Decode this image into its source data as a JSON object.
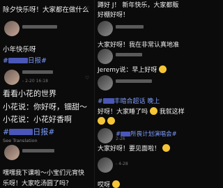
{
  "left": {
    "c1": {
      "text": "除夕快乐呀！大家都在做什么"
    },
    "c2": {
      "line1": "小年快乐呀",
      "tag_suffix": "日报#"
    },
    "c3": {
      "meta": "- 2-20 16:18",
      "line1": "看看小花的世界",
      "line2": "小花说：你好呀，钿甜～",
      "line3": "小花说：小花好香啊",
      "tag_suffix": "日报#",
      "see_translation": "See Translation"
    },
    "c4": {
      "line1": "嘿嘿我下课啦～小宝们元宵快",
      "line2": "乐呀！大家吃汤圆了吗？"
    }
  },
  "right": {
    "c1": {
      "line1": "蹲好 J！ 新年快乐，大家都贩",
      "line2": "好棚好呀！"
    },
    "c2": {
      "line1": "大家好呀！我在非常认真地准"
    },
    "c3": {
      "line1": "Jeremy说：早上好呀"
    },
    "c4": {
      "tag_text": "丰暗合超话 晚上",
      "line2": "好呀！大家睡了吗",
      "line3": "我就这样"
    },
    "c5": {
      "meta": "2-26",
      "tag_text": "所畏计划演唱会#",
      "line1": "大家好呀！要见面啦！"
    },
    "c6": {
      "meta": "- 4-28",
      "line1": "哎呀"
    }
  }
}
